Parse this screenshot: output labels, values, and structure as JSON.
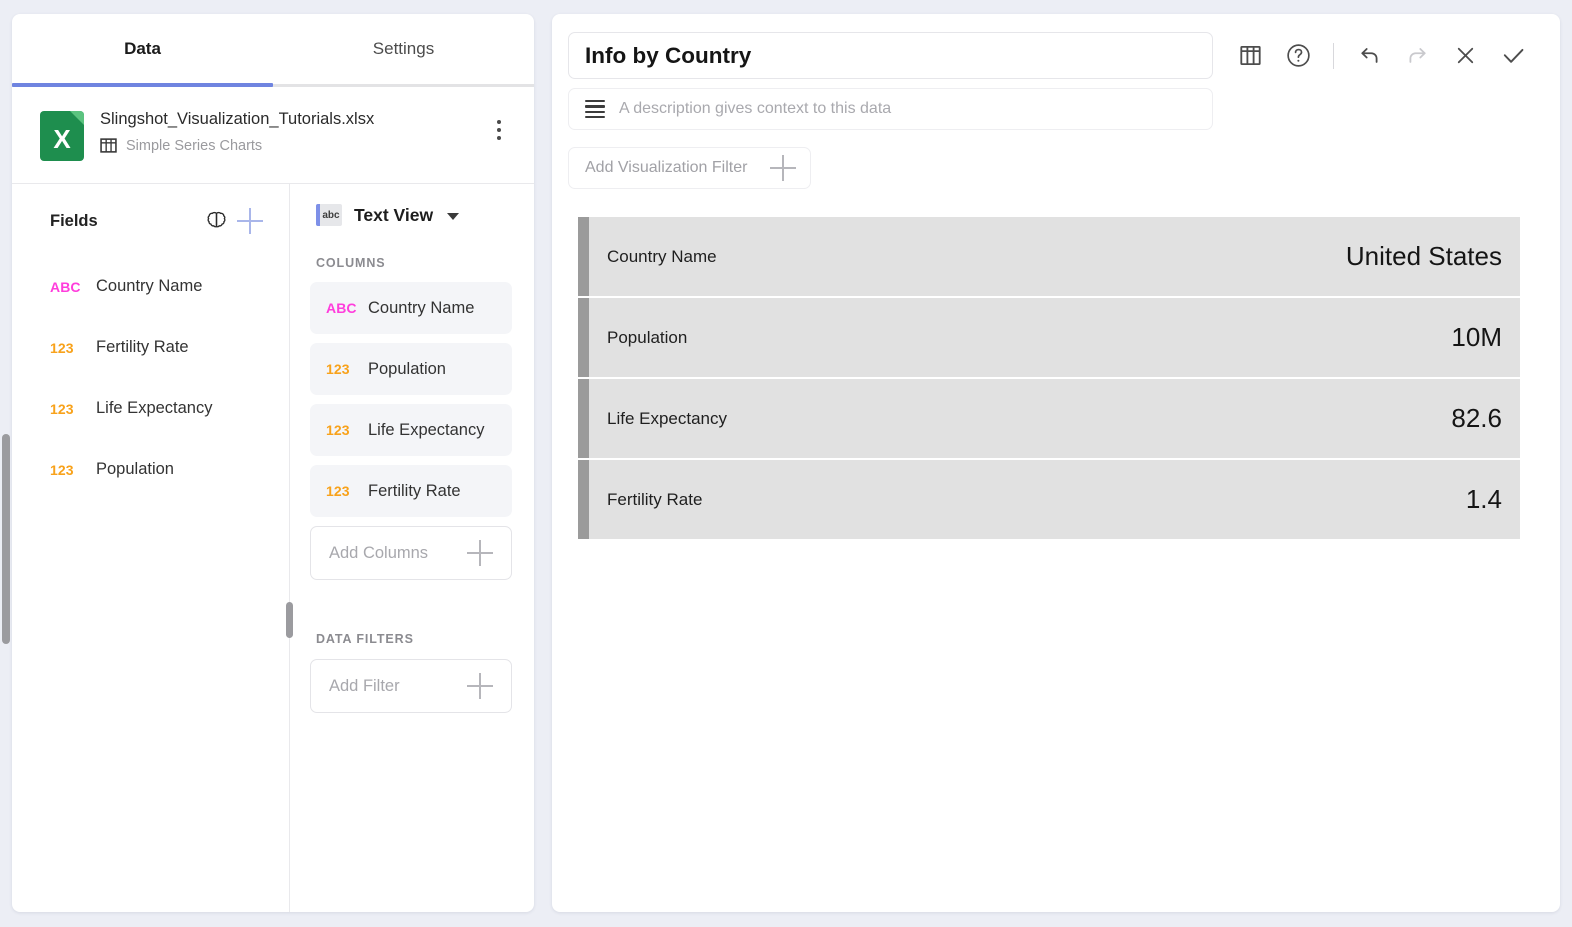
{
  "left_panel": {
    "tabs": [
      {
        "label": "Data",
        "active": true
      },
      {
        "label": "Settings",
        "active": false
      }
    ],
    "file": {
      "icon": "excel-file-icon",
      "icon_letter": "X",
      "name": "Slingshot_Visualization_Tutorials.xlsx",
      "sheet_icon": "table-icon",
      "sheet_name": "Simple Series Charts",
      "menu_icon": "kebab-menu-icon"
    },
    "fields": {
      "title": "Fields",
      "brain_icon": "brain-icon",
      "add_icon": "plus-icon",
      "items": [
        {
          "type": "ABC",
          "label": "Country Name"
        },
        {
          "type": "123",
          "label": "Fertility Rate"
        },
        {
          "type": "123",
          "label": "Life Expectancy"
        },
        {
          "type": "123",
          "label": "Population"
        }
      ]
    },
    "view": {
      "badge_text": "abc",
      "badge_icon": "text-view-icon",
      "label": "Text View",
      "chevron_icon": "chevron-down-icon"
    },
    "columns_section": {
      "label": "COLUMNS",
      "items": [
        {
          "type": "ABC",
          "label": "Country Name"
        },
        {
          "type": "123",
          "label": "Population"
        },
        {
          "type": "123",
          "label": "Life Expectancy"
        },
        {
          "type": "123",
          "label": "Fertility Rate"
        }
      ],
      "add_label": "Add Columns",
      "add_icon": "plus-icon"
    },
    "filters_section": {
      "label": "DATA FILTERS",
      "add_label": "Add Filter",
      "add_icon": "plus-icon"
    }
  },
  "right_panel": {
    "title": "Info by Country",
    "description_placeholder": "A description gives context to this data",
    "description_icon": "description-lines-icon",
    "viz_filter_label": "Add Visualization Filter",
    "viz_filter_icon": "plus-icon",
    "toolbar": [
      {
        "name": "table-view-icon",
        "label": "Table View",
        "disabled": false
      },
      {
        "name": "help-icon",
        "label": "Help",
        "disabled": false
      },
      {
        "name": "undo-icon",
        "label": "Undo",
        "disabled": false
      },
      {
        "name": "redo-icon",
        "label": "Redo",
        "disabled": true
      },
      {
        "name": "close-icon",
        "label": "Close",
        "disabled": false
      },
      {
        "name": "confirm-check-icon",
        "label": "Confirm",
        "disabled": false
      }
    ],
    "rows": [
      {
        "key": "Country Name",
        "value": "United States"
      },
      {
        "key": "Population",
        "value": "10M"
      },
      {
        "key": "Life Expectancy",
        "value": "82.6"
      },
      {
        "key": "Fertility Rate",
        "value": "1.4"
      }
    ]
  },
  "colors": {
    "accent_blue": "#6f84e0",
    "type_text": "#ff3ddc",
    "type_number": "#f8a21b",
    "excel_green": "#1e8e4e",
    "row_bg": "#e1e1e1",
    "row_accent": "#9b9b9b",
    "page_bg": "#eceef5"
  }
}
